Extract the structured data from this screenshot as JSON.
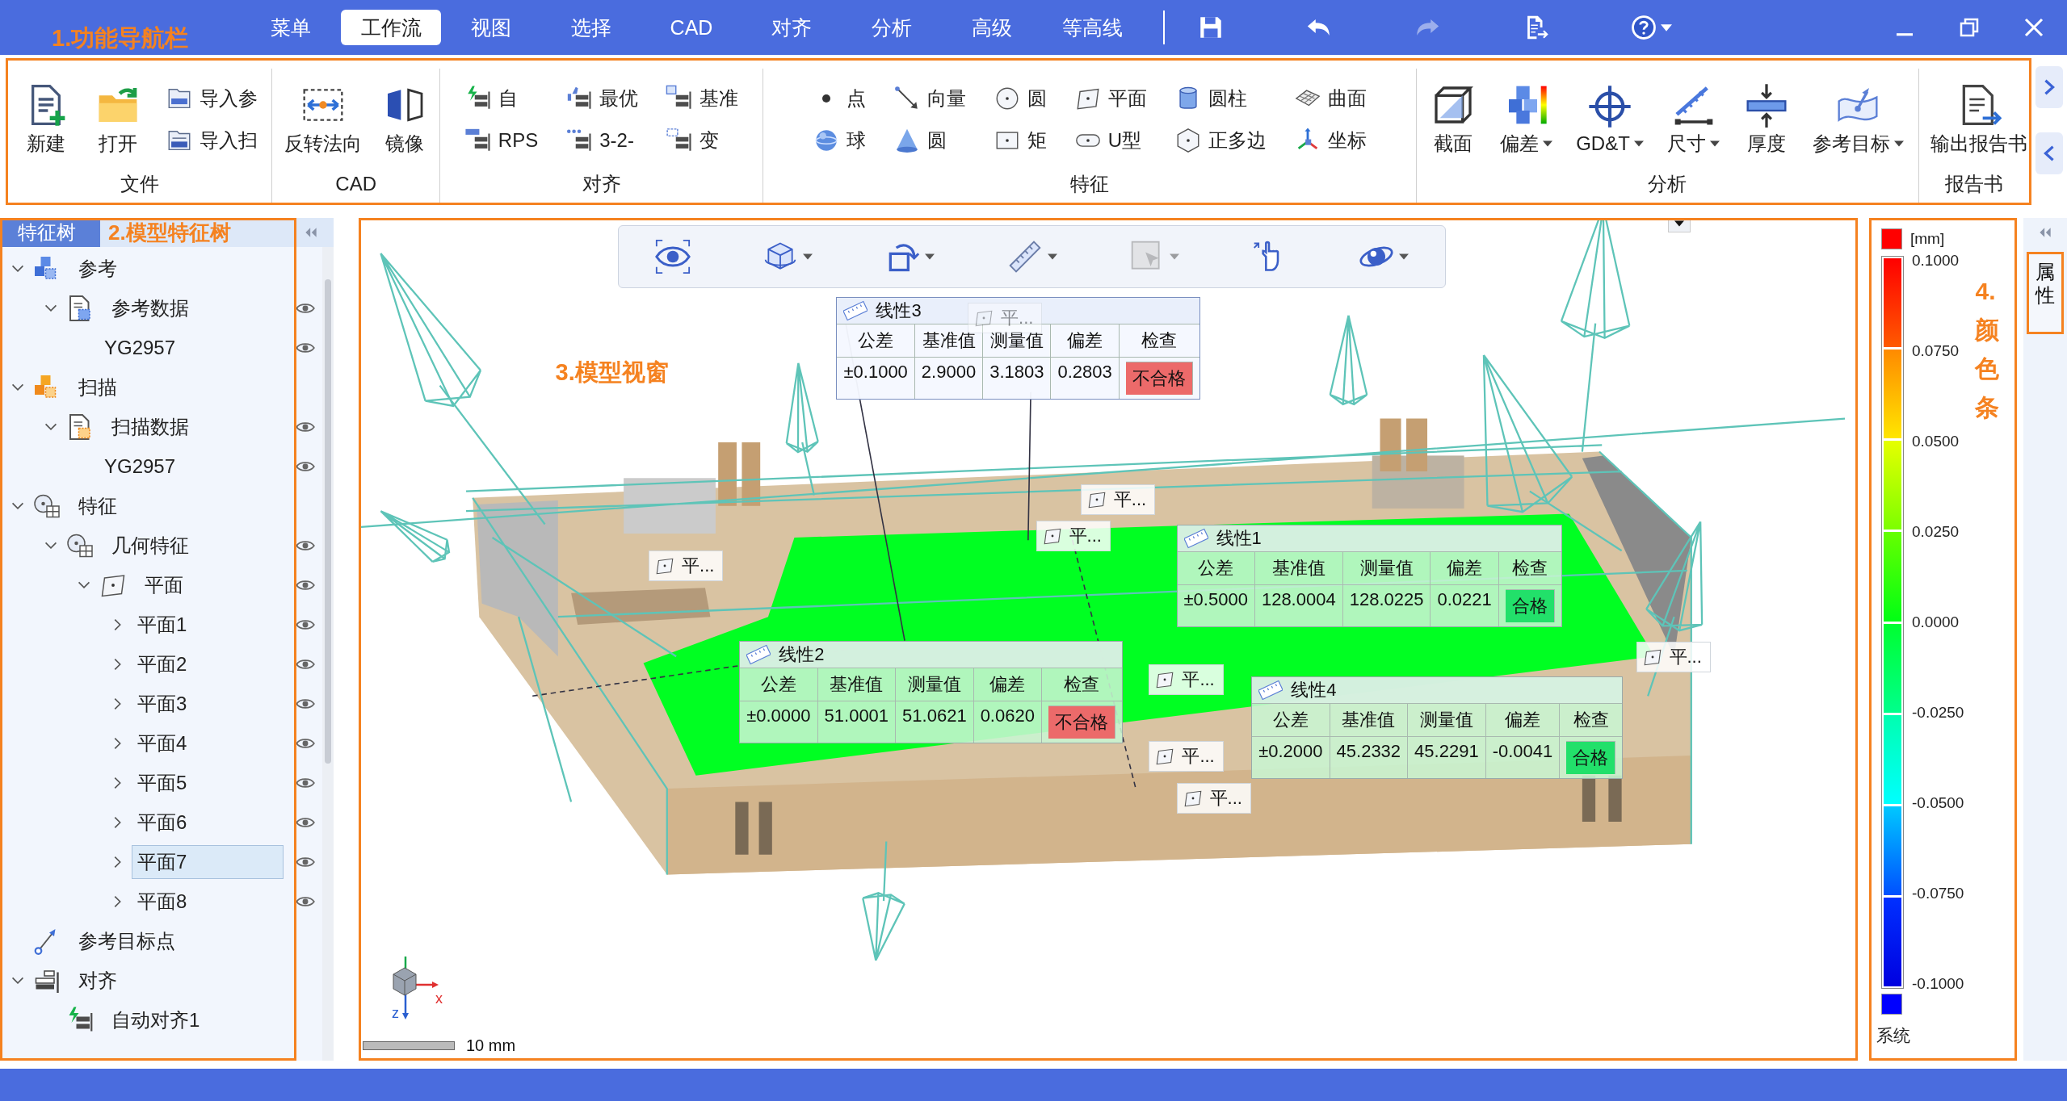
{
  "title_bar": {
    "annotation": "1.功能导航栏",
    "tabs": [
      {
        "label": "菜单",
        "selected": false
      },
      {
        "label": "工作流",
        "selected": true
      },
      {
        "label": "视图",
        "selected": false
      },
      {
        "label": "选择",
        "selected": false
      },
      {
        "label": "CAD",
        "selected": false
      },
      {
        "label": "对齐",
        "selected": false
      },
      {
        "label": "分析",
        "selected": false
      },
      {
        "label": "高级",
        "selected": false
      },
      {
        "label": "等高线",
        "selected": false
      }
    ],
    "quick_actions": [
      {
        "disabled": false
      },
      {
        "disabled": false
      },
      {
        "disabled": true
      },
      {
        "disabled": false
      },
      {
        "disabled": false,
        "dropdown": true
      }
    ]
  },
  "ribbon": {
    "groups": [
      {
        "label": "文件",
        "items": [
          {
            "label": "新建",
            "kind": "large",
            "dropdown": false
          },
          {
            "label": "打开",
            "kind": "large",
            "dropdown": false
          },
          {
            "label": "导入参",
            "kind": "small",
            "dropdown": false
          },
          {
            "label": "导入扫",
            "kind": "small",
            "dropdown": false
          }
        ]
      },
      {
        "label": "CAD",
        "items": [
          {
            "label": "反转法向",
            "kind": "large",
            "dropdown": false
          },
          {
            "label": "镜像",
            "kind": "large",
            "dropdown": false
          }
        ]
      },
      {
        "label": "对齐",
        "items": [
          {
            "label": "自",
            "kind": "small",
            "dropdown": false
          },
          {
            "label": "RPS",
            "kind": "small",
            "dropdown": false
          },
          {
            "label": "最优",
            "kind": "small",
            "dropdown": false
          },
          {
            "label": "3-2-",
            "kind": "small",
            "dropdown": false
          },
          {
            "label": "基准",
            "kind": "small",
            "dropdown": false
          },
          {
            "label": "变",
            "kind": "small",
            "dropdown": false
          }
        ]
      },
      {
        "label": "特征",
        "items": [
          {
            "label": "点",
            "kind": "small",
            "dropdown": false
          },
          {
            "label": "球",
            "kind": "small",
            "dropdown": false
          },
          {
            "label": "向量",
            "kind": "small",
            "dropdown": false
          },
          {
            "label": "圆",
            "kind": "small",
            "dropdown": false
          },
          {
            "label": "圆",
            "kind": "small",
            "dropdown": false
          },
          {
            "label": "矩",
            "kind": "small",
            "dropdown": false
          },
          {
            "label": "平面",
            "kind": "small",
            "dropdown": false
          },
          {
            "label": "U型",
            "kind": "small",
            "dropdown": false
          },
          {
            "label": "圆柱",
            "kind": "small",
            "dropdown": false
          },
          {
            "label": "正多边",
            "kind": "small",
            "dropdown": false
          },
          {
            "label": "曲面",
            "kind": "small",
            "dropdown": false
          },
          {
            "label": "坐标",
            "kind": "small",
            "dropdown": false
          }
        ]
      },
      {
        "label": "分析",
        "items": [
          {
            "label": "截面",
            "kind": "large",
            "dropdown": false
          },
          {
            "label": "偏差",
            "kind": "large",
            "dropdown": true
          },
          {
            "label": "GD&T",
            "kind": "large",
            "dropdown": true
          },
          {
            "label": "尺寸",
            "kind": "large",
            "dropdown": true
          },
          {
            "label": "厚度",
            "kind": "large",
            "dropdown": false
          },
          {
            "label": "参考目标",
            "kind": "large",
            "dropdown": true
          }
        ]
      },
      {
        "label": "报告书",
        "items": [
          {
            "label": "输出报告书",
            "kind": "large",
            "dropdown": false
          }
        ]
      }
    ]
  },
  "feature_tree": {
    "tab": "特征树",
    "annotation": "2.模型特征树",
    "items": [
      {
        "label": "参考",
        "kind": "reference",
        "expanded": true,
        "selected": false,
        "visible": false,
        "children": [
          {
            "label": "参考数据",
            "kind": "reference-data",
            "expanded": true,
            "selected": false,
            "visible": true,
            "children": [
              {
                "label": "YG2957",
                "selected": false,
                "visible": true
              }
            ]
          }
        ]
      },
      {
        "label": "扫描",
        "kind": "scan",
        "expanded": true,
        "selected": false,
        "visible": false,
        "children": [
          {
            "label": "扫描数据",
            "kind": "scan-data",
            "expanded": true,
            "selected": false,
            "visible": true,
            "children": [
              {
                "label": "YG2957",
                "selected": false,
                "visible": true
              }
            ]
          }
        ]
      },
      {
        "label": "特征",
        "kind": "features",
        "expanded": true,
        "selected": false,
        "visible": false,
        "children": [
          {
            "label": "几何特征",
            "kind": "features",
            "expanded": true,
            "selected": false,
            "visible": true,
            "children": [
              {
                "label": "平面",
                "kind": "plane",
                "expanded": true,
                "selected": false,
                "visible": true,
                "children": [
                  {
                    "label": "平面1",
                    "expanded": false,
                    "selected": false,
                    "visible": true
                  },
                  {
                    "label": "平面2",
                    "expanded": false,
                    "selected": false,
                    "visible": true
                  },
                  {
                    "label": "平面3",
                    "expanded": false,
                    "selected": false,
                    "visible": true
                  },
                  {
                    "label": "平面4",
                    "expanded": false,
                    "selected": false,
                    "visible": true
                  },
                  {
                    "label": "平面5",
                    "expanded": false,
                    "selected": false,
                    "visible": true
                  },
                  {
                    "label": "平面6",
                    "expanded": false,
                    "selected": false,
                    "visible": true
                  },
                  {
                    "label": "平面7",
                    "expanded": false,
                    "selected": true,
                    "visible": true
                  },
                  {
                    "label": "平面8",
                    "expanded": false,
                    "selected": false,
                    "visible": true
                  }
                ]
              }
            ]
          }
        ]
      },
      {
        "label": "参考目标点",
        "kind": "target",
        "selected": false,
        "visible": false
      },
      {
        "label": "对齐",
        "kind": "align",
        "expanded": true,
        "selected": false,
        "visible": false,
        "children": [
          {
            "label": "自动对齐1",
            "kind": "auto-align",
            "selected": false,
            "visible": false
          }
        ]
      }
    ]
  },
  "viewport": {
    "annotation": "3.模型视窗",
    "toolbar": [
      {
        "dropdown": false,
        "disabled": false
      },
      {
        "dropdown": true,
        "disabled": false
      },
      {
        "dropdown": true,
        "disabled": false
      },
      {
        "dropdown": true,
        "disabled": false
      },
      {
        "dropdown": true,
        "disabled": true
      },
      {
        "dropdown": false,
        "disabled": false
      },
      {
        "dropdown": true,
        "disabled": false
      }
    ],
    "measurements": [
      {
        "title": "线性3",
        "highlighted": true,
        "columns": [
          "公差",
          "基准值",
          "测量值",
          "偏差",
          "检查"
        ],
        "values": [
          "±0.1000",
          "2.9000",
          "3.1803",
          "0.2803",
          "不合格"
        ],
        "passed": false
      },
      {
        "title": "线性1",
        "highlighted": false,
        "columns": [
          "公差",
          "基准值",
          "测量值",
          "偏差",
          "检查"
        ],
        "values": [
          "±0.5000",
          "128.0004",
          "128.0225",
          "0.0221",
          "合格"
        ],
        "passed": true
      },
      {
        "title": "线性2",
        "highlighted": false,
        "columns": [
          "公差",
          "基准值",
          "测量值",
          "偏差",
          "检查"
        ],
        "values": [
          "±0.0000",
          "51.0001",
          "51.0621",
          "0.0620",
          "不合格"
        ],
        "passed": false
      },
      {
        "title": "线性4",
        "highlighted": false,
        "columns": [
          "公差",
          "基准值",
          "测量值",
          "偏差",
          "检查"
        ],
        "values": [
          "±0.2000",
          "45.2332",
          "45.2291",
          "-0.0041",
          "合格"
        ],
        "passed": true
      }
    ],
    "plane_labels": [
      {
        "label": "平...",
        "faded": true
      },
      {
        "label": "平...",
        "faded": false
      },
      {
        "label": "平...",
        "faded": false
      },
      {
        "label": "平...",
        "faded": false
      },
      {
        "label": "平...",
        "faded": false
      },
      {
        "label": "平...",
        "faded": false
      },
      {
        "label": "平...",
        "faded": false
      },
      {
        "label": "平...",
        "faded": false
      }
    ],
    "axis_labels": [
      "x",
      "z"
    ],
    "scale_label": "10 mm"
  },
  "color_legend": {
    "annotation": "4.颜色条",
    "unit": "[mm]",
    "ticks": [
      "0.1000",
      "0.0750",
      "0.0500",
      "0.0250",
      "0.0000",
      "-0.0250",
      "-0.0500",
      "-0.0750",
      "-0.1000"
    ],
    "footer": "系统"
  },
  "side_panel": {
    "tabs": [
      {
        "label": "属性"
      }
    ]
  }
}
